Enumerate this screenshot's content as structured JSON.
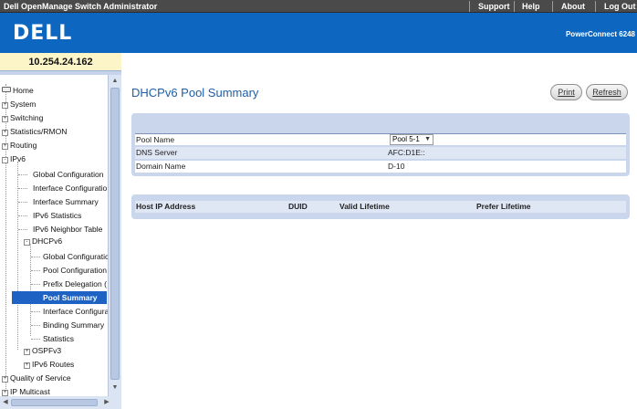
{
  "window": {
    "app_title": "Dell OpenManage Switch Administrator",
    "links": [
      "Support",
      "Help",
      "About",
      "Log Out"
    ]
  },
  "banner": {
    "logo_text": "DELL",
    "product_name": "PowerConnect 6248"
  },
  "sidebar": {
    "ip_address": "10.254.24.162",
    "tree": [
      {
        "label": "Home",
        "level": 0,
        "kind": "folder"
      },
      {
        "label": "System",
        "level": 0,
        "kind": "expander",
        "state": "+"
      },
      {
        "label": "Switching",
        "level": 0,
        "kind": "expander",
        "state": "+"
      },
      {
        "label": "Statistics/RMON",
        "level": 0,
        "kind": "expander",
        "state": "+"
      },
      {
        "label": "Routing",
        "level": 0,
        "kind": "expander",
        "state": "+"
      },
      {
        "label": "IPv6",
        "level": 0,
        "kind": "expander",
        "state": "-"
      },
      {
        "label": "Global Configuration",
        "level": 1,
        "kind": "leaf"
      },
      {
        "label": "Interface Configuratio",
        "level": 1,
        "kind": "leaf"
      },
      {
        "label": "Interface Summary",
        "level": 1,
        "kind": "leaf"
      },
      {
        "label": "IPv6 Statistics",
        "level": 1,
        "kind": "leaf"
      },
      {
        "label": "IPv6 Neighbor Table",
        "level": 1,
        "kind": "leaf"
      },
      {
        "label": "DHCPv6",
        "level": 1,
        "kind": "expander",
        "state": "-"
      },
      {
        "label": "Global Configuratic",
        "level": 2,
        "kind": "leaf"
      },
      {
        "label": "Pool Configuration",
        "level": 2,
        "kind": "leaf"
      },
      {
        "label": "Prefix Delegation (",
        "level": 2,
        "kind": "leaf"
      },
      {
        "label": "Pool Summary",
        "level": 2,
        "kind": "leaf",
        "selected": true
      },
      {
        "label": "Interface Configura",
        "level": 2,
        "kind": "leaf"
      },
      {
        "label": "Binding Summary",
        "level": 2,
        "kind": "leaf"
      },
      {
        "label": "Statistics",
        "level": 2,
        "kind": "leaf"
      },
      {
        "label": "OSPFv3",
        "level": 1,
        "kind": "expander",
        "state": "+"
      },
      {
        "label": "IPv6 Routes",
        "level": 1,
        "kind": "expander",
        "state": "+"
      },
      {
        "label": "Quality of Service",
        "level": 0,
        "kind": "expander",
        "state": "+"
      },
      {
        "label": "IP Multicast",
        "level": 0,
        "kind": "expander",
        "state": "+"
      }
    ],
    "selection_color": "#1e62c4"
  },
  "main": {
    "title": "DHCPv6 Pool Summary",
    "print_label": "Print",
    "refresh_label": "Refresh",
    "pool_fields": {
      "pool_name_label": "Pool Name",
      "pool_name_value": "Pool 5-1",
      "dns_server_label": "DNS Server",
      "dns_server_value": "AFC:D1E::",
      "domain_name_label": "Domain Name",
      "domain_name_value": "D-10"
    },
    "hosts_table": {
      "columns": [
        "Host IP Address",
        "DUID",
        "Valid Lifetime",
        "Prefer Lifetime"
      ],
      "rows": []
    }
  },
  "colors": {
    "banner": "#0d66bf",
    "title": "#1e5ea8",
    "panel": "#c9d6ec"
  }
}
